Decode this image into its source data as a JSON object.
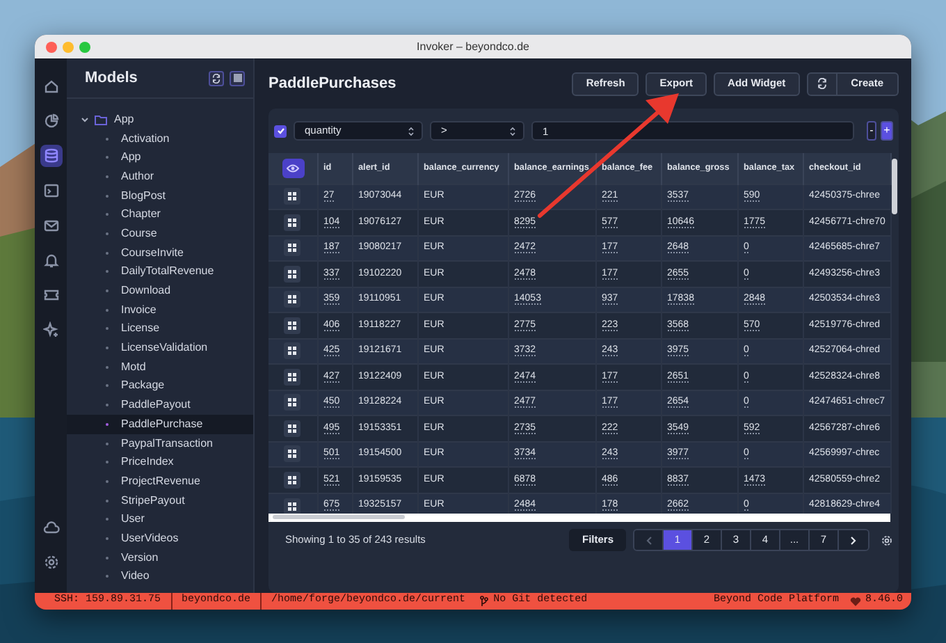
{
  "window": {
    "title": "Invoker – beyondco.de"
  },
  "rail": {
    "items": [
      {
        "kind": "home",
        "selected": false
      },
      {
        "kind": "pie",
        "selected": false
      },
      {
        "kind": "database",
        "selected": true
      },
      {
        "kind": "terminal",
        "selected": false
      },
      {
        "kind": "mail",
        "selected": false
      },
      {
        "kind": "bell",
        "selected": false
      },
      {
        "kind": "ticket",
        "selected": false
      },
      {
        "kind": "sparkle",
        "selected": false
      }
    ],
    "bottom": [
      {
        "kind": "cloud",
        "selected": false
      },
      {
        "kind": "gear",
        "selected": false
      }
    ]
  },
  "sidebar": {
    "title": "Models",
    "folder": {
      "label": "App",
      "expanded": true,
      "children": [
        {
          "label": "Activation",
          "selected": false
        },
        {
          "label": "App",
          "selected": false
        },
        {
          "label": "Author",
          "selected": false
        },
        {
          "label": "BlogPost",
          "selected": false
        },
        {
          "label": "Chapter",
          "selected": false
        },
        {
          "label": "Course",
          "selected": false
        },
        {
          "label": "CourseInvite",
          "selected": false
        },
        {
          "label": "DailyTotalRevenue",
          "selected": false
        },
        {
          "label": "Download",
          "selected": false
        },
        {
          "label": "Invoice",
          "selected": false
        },
        {
          "label": "License",
          "selected": false
        },
        {
          "label": "LicenseValidation",
          "selected": false
        },
        {
          "label": "Motd",
          "selected": false
        },
        {
          "label": "Package",
          "selected": false
        },
        {
          "label": "PaddlePayout",
          "selected": false
        },
        {
          "label": "PaddlePurchase",
          "selected": true
        },
        {
          "label": "PaypalTransaction",
          "selected": false
        },
        {
          "label": "PriceIndex",
          "selected": false
        },
        {
          "label": "ProjectRevenue",
          "selected": false
        },
        {
          "label": "StripePayout",
          "selected": false
        },
        {
          "label": "User",
          "selected": false
        },
        {
          "label": "UserVideos",
          "selected": false
        },
        {
          "label": "Version",
          "selected": false
        },
        {
          "label": "Video",
          "selected": false
        }
      ]
    }
  },
  "page": {
    "title": "PaddlePurchases",
    "buttons": [
      "Refresh",
      "Export",
      "Add Widget"
    ],
    "create": "Create"
  },
  "filter": {
    "enabled": true,
    "field": "quantity",
    "operator": ">",
    "value": "1",
    "remove": "-",
    "add": "+"
  },
  "table": {
    "columns": [
      "id",
      "alert_id",
      "balance_currency",
      "balance_earnings",
      "balance_fee",
      "balance_gross",
      "balance_tax",
      "checkout_id"
    ],
    "rows": [
      [
        "27",
        "19073044",
        "EUR",
        "2726",
        "221",
        "3537",
        "590",
        "42450375-chree"
      ],
      [
        "104",
        "19076127",
        "EUR",
        "8295",
        "577",
        "10646",
        "1775",
        "42456771-chre70"
      ],
      [
        "187",
        "19080217",
        "EUR",
        "2472",
        "177",
        "2648",
        "0",
        "42465685-chre7"
      ],
      [
        "337",
        "19102220",
        "EUR",
        "2478",
        "177",
        "2655",
        "0",
        "42493256-chre3"
      ],
      [
        "359",
        "19110951",
        "EUR",
        "14053",
        "937",
        "17838",
        "2848",
        "42503534-chre3"
      ],
      [
        "406",
        "19118227",
        "EUR",
        "2775",
        "223",
        "3568",
        "570",
        "42519776-chred"
      ],
      [
        "425",
        "19121671",
        "EUR",
        "3732",
        "243",
        "3975",
        "0",
        "42527064-chred"
      ],
      [
        "427",
        "19122409",
        "EUR",
        "2474",
        "177",
        "2651",
        "0",
        "42528324-chre8"
      ],
      [
        "450",
        "19128224",
        "EUR",
        "2477",
        "177",
        "2654",
        "0",
        "42474651-chrec7"
      ],
      [
        "495",
        "19153351",
        "EUR",
        "2735",
        "222",
        "3549",
        "592",
        "42567287-chre6"
      ],
      [
        "501",
        "19154500",
        "EUR",
        "3734",
        "243",
        "3977",
        "0",
        "42569997-chrec"
      ],
      [
        "521",
        "19159535",
        "EUR",
        "6878",
        "486",
        "8837",
        "1473",
        "42580559-chre2"
      ],
      [
        "675",
        "19325157",
        "EUR",
        "2484",
        "178",
        "2662",
        "0",
        "42818629-chre4"
      ]
    ]
  },
  "footer": {
    "summary": "Showing 1 to 35 of 243 results",
    "filters": "Filters",
    "pages": [
      {
        "label": "1",
        "selected": true
      },
      {
        "label": "2",
        "selected": false
      },
      {
        "label": "3",
        "selected": false
      },
      {
        "label": "4",
        "selected": false
      },
      {
        "label": "...",
        "selected": false
      },
      {
        "label": "7",
        "selected": false
      }
    ],
    "prev_disabled": true
  },
  "status_bar": {
    "ssh": "SSH: 159.89.31.75",
    "host": "beyondco.de",
    "path": "/home/forge/beyondco.de/current",
    "git": "No Git detected",
    "platform": "Beyond Code Platform",
    "version": "8.46.0"
  }
}
